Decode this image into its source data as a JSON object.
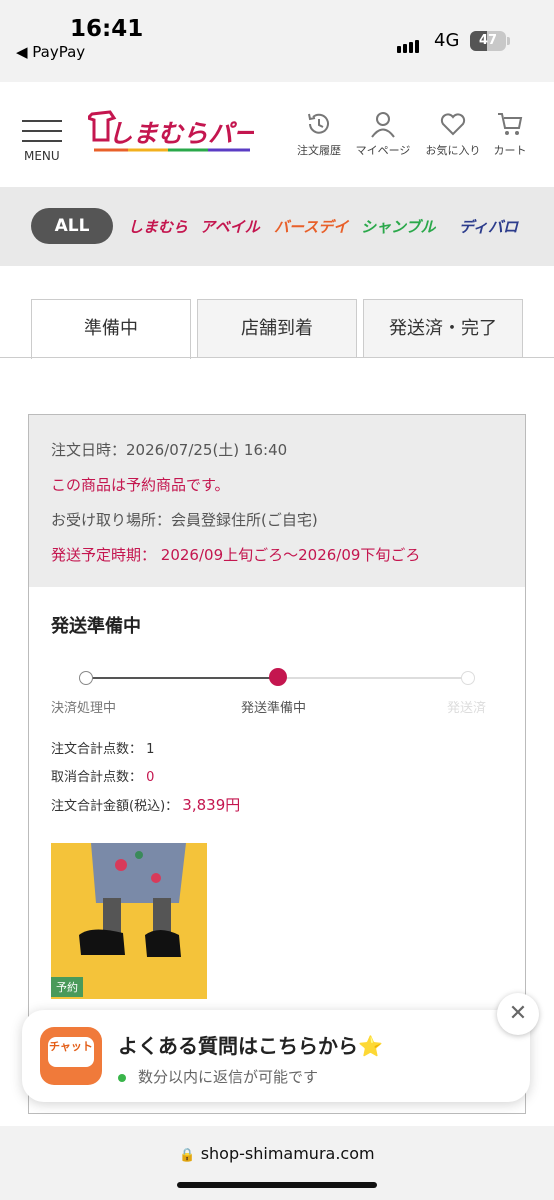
{
  "status_bar": {
    "time": "16:41",
    "back_app": "◀ PayPay",
    "network": "4G",
    "battery": "47"
  },
  "header": {
    "menu_label": "MENU",
    "logo_text": "しまむらパーク",
    "icons": [
      {
        "name": "history-icon",
        "label": "注文履歴"
      },
      {
        "name": "user-icon",
        "label": "マイページ"
      },
      {
        "name": "heart-icon",
        "label": "お気に入り"
      },
      {
        "name": "cart-icon",
        "label": "カート"
      }
    ]
  },
  "brands": {
    "all": "ALL",
    "items": [
      {
        "label": "しまむら",
        "color": "#c4164f"
      },
      {
        "label": "アベイル",
        "color": "#c4164f"
      },
      {
        "label": "バースデイ",
        "color": "#e8602a"
      },
      {
        "label": "シャンブル",
        "color": "#2aa84a"
      },
      {
        "label": "ディバロ",
        "color": "#2c3c8c"
      }
    ]
  },
  "tabs": [
    "準備中",
    "店舗到着",
    "発送済・完了"
  ],
  "order": {
    "date": "注文日時：2026/07/25(土) 16:40",
    "preorder_note": "この商品は予約商品です。",
    "pickup": "お受け取り場所：会員登録住所(ご自宅)",
    "ship_label": "発送予定時期：",
    "ship_value": "2026/09上旬ごろ〜2026/09下旬ごろ",
    "section_title": "発送準備中",
    "steps": [
      "決済処理中",
      "発送準備中",
      "発送済"
    ],
    "current_step": 2,
    "summary": [
      {
        "label": "注文合計点数：",
        "value": "1"
      },
      {
        "label": "取消合計点数：",
        "value": "0"
      },
      {
        "label": "注文合計金額(税込)：",
        "value": "3,839円"
      }
    ],
    "product_badge": "予約"
  },
  "chat": {
    "icon_text": "チャット",
    "title": "よくある質問はこちらから⭐",
    "subtitle": "数分以内に返信が可能です"
  },
  "url": "shop-shimamura.com"
}
